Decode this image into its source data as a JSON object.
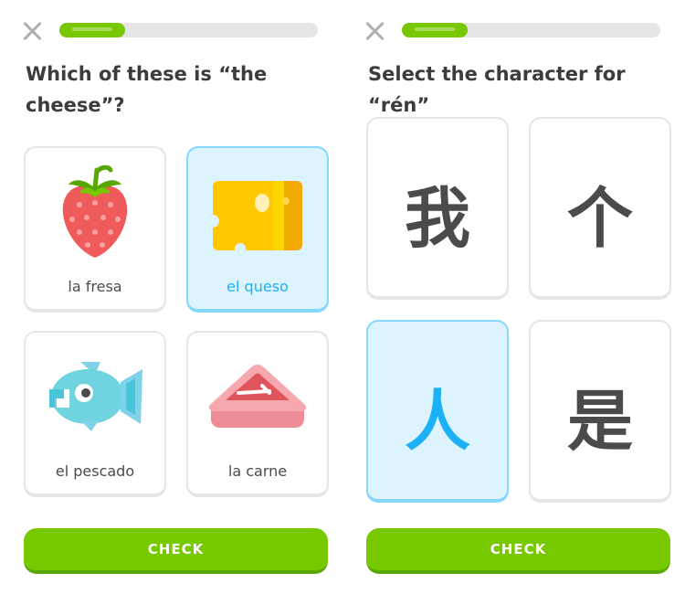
{
  "colors": {
    "accent_green": "#78c800",
    "selected_bg": "#ddf4ff",
    "selected_border": "#84d8ff",
    "selected_text": "#1cb0f6",
    "neutral_text": "#4b4b4b"
  },
  "left": {
    "progress": 0.25,
    "prompt": "Which of these is “the cheese”?",
    "options": [
      {
        "label": "la fresa",
        "icon": "strawberry-icon",
        "selected": false
      },
      {
        "label": "el queso",
        "icon": "cheese-icon",
        "selected": true
      },
      {
        "label": "el pescado",
        "icon": "fish-icon",
        "selected": false
      },
      {
        "label": "la carne",
        "icon": "meat-icon",
        "selected": false
      }
    ],
    "check_label": "CHECK"
  },
  "right": {
    "progress": 0.25,
    "prompt": "Select the character for “rén”",
    "options": [
      {
        "char": "我",
        "selected": false
      },
      {
        "char": "个",
        "selected": false
      },
      {
        "char": "人",
        "selected": true
      },
      {
        "char": "是",
        "selected": false
      }
    ],
    "check_label": "CHECK"
  }
}
